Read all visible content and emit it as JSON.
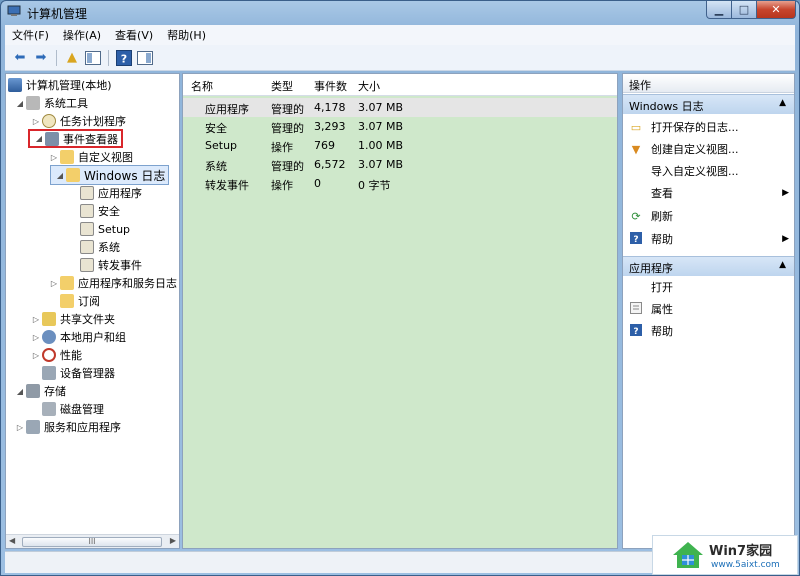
{
  "window": {
    "title": "计算机管理"
  },
  "menu": [
    "文件(F)",
    "操作(A)",
    "查看(V)",
    "帮助(H)"
  ],
  "tree": {
    "root": "计算机管理(本地)",
    "system_tools": "系统工具",
    "task_scheduler": "任务计划程序",
    "event_viewer": "事件查看器",
    "custom_views": "自定义视图",
    "windows_logs": "Windows 日志",
    "app_log": "应用程序",
    "security_log": "安全",
    "setup_log": "Setup",
    "system_log": "系统",
    "forwarded_log": "转发事件",
    "app_service_logs": "应用程序和服务日志",
    "subscriptions": "订阅",
    "shared_folders": "共享文件夹",
    "local_users": "本地用户和组",
    "performance": "性能",
    "device_manager": "设备管理器",
    "storage": "存储",
    "disk_management": "磁盘管理",
    "services_apps": "服务和应用程序",
    "scroll_thumb": "III"
  },
  "list": {
    "columns": [
      "名称",
      "类型",
      "事件数",
      "大小"
    ],
    "rows": [
      [
        "应用程序",
        "管理的",
        "4,178",
        "3.07 MB"
      ],
      [
        "安全",
        "管理的",
        "3,293",
        "3.07 MB"
      ],
      [
        "Setup",
        "操作",
        "769",
        "1.00 MB"
      ],
      [
        "系统",
        "管理的",
        "6,572",
        "3.07 MB"
      ],
      [
        "转发事件",
        "操作",
        "0",
        "0 字节"
      ]
    ]
  },
  "actions": {
    "header": "操作",
    "section1": "Windows 日志",
    "items1": [
      "打开保存的日志...",
      "创建自定义视图...",
      "导入自定义视图...",
      "查看",
      "刷新",
      "帮助"
    ],
    "section2": "应用程序",
    "items2": [
      "打开",
      "属性",
      "帮助"
    ]
  },
  "watermark": {
    "brand": "Win7家园",
    "url": "www.5aixt.com"
  },
  "colors": {
    "list_bg": "#cfe8cb",
    "highlight": "#d9262b",
    "window_frame": "#9cbfe2"
  }
}
